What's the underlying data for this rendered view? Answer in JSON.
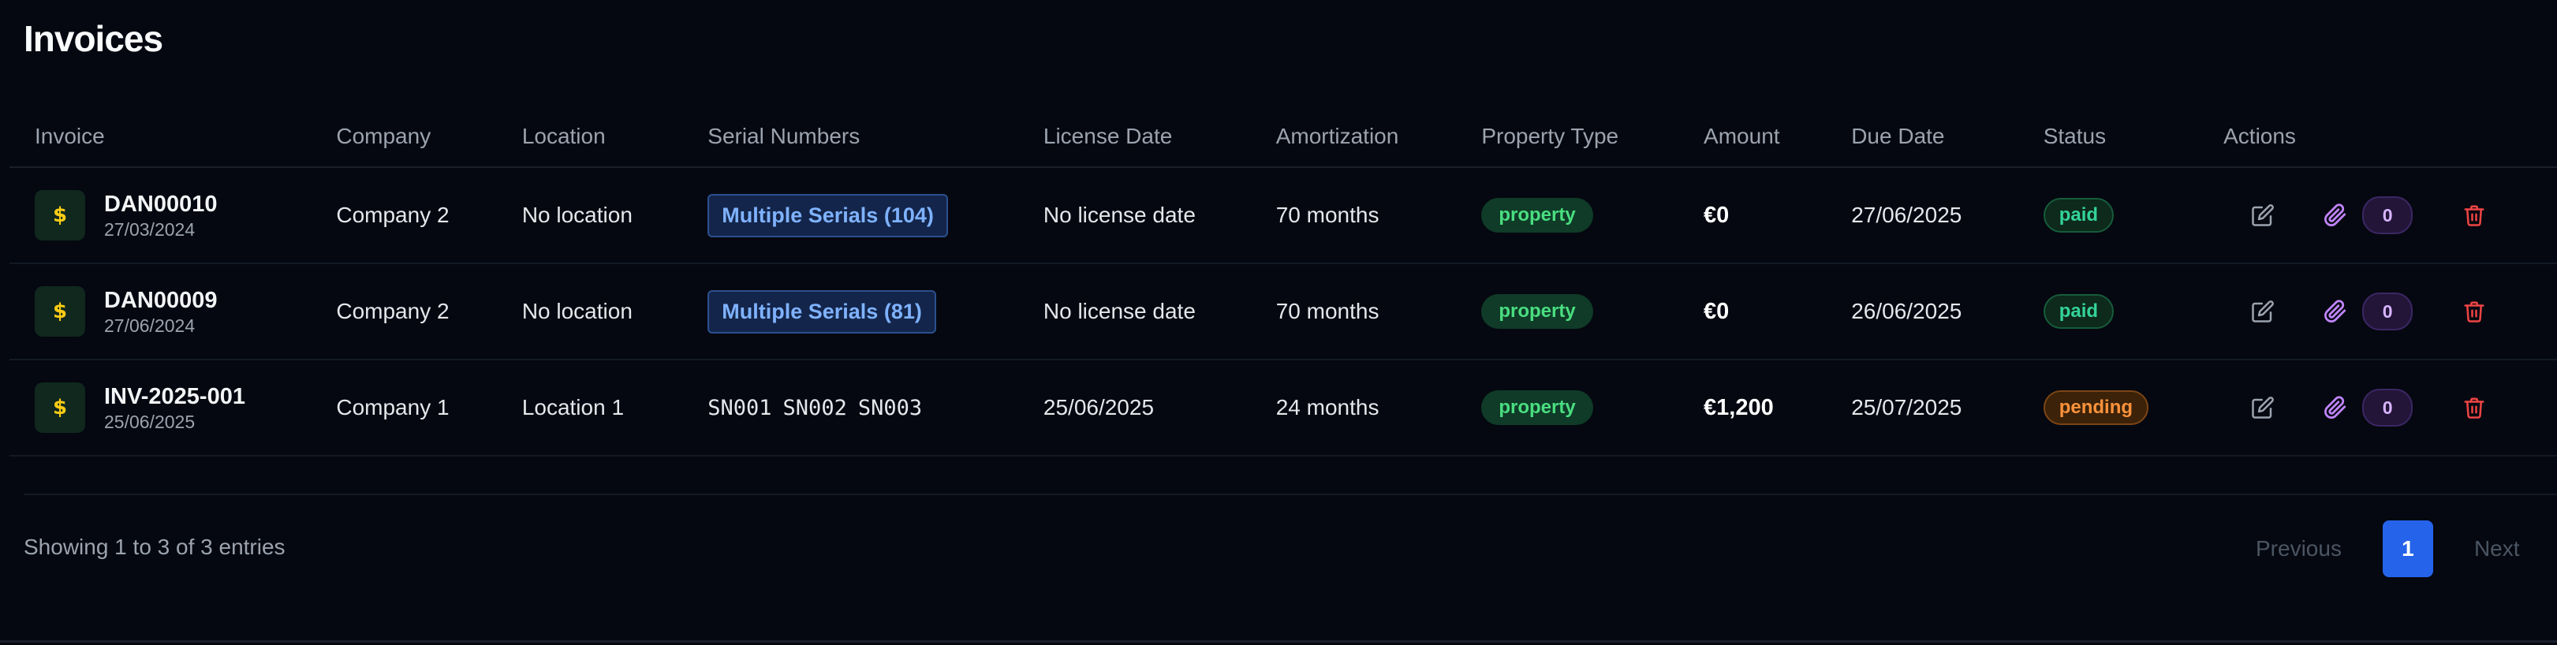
{
  "page": {
    "title": "Invoices"
  },
  "table": {
    "headers": [
      "Invoice",
      "Company",
      "Location",
      "Serial Numbers",
      "License Date",
      "Amortization",
      "Property Type",
      "Amount",
      "Due Date",
      "Status",
      "Actions"
    ],
    "rows": [
      {
        "invoice_number": "DAN00010",
        "invoice_date": "27/03/2024",
        "icon": "money-bag-icon",
        "company": "Company 2",
        "location": "No location",
        "serials_badge": "Multiple Serials (104)",
        "license_date": "No license date",
        "amortization": "70 months",
        "property_type": "property",
        "amount": "€0",
        "due_date": "27/06/2025",
        "status": "paid",
        "attachments": "0"
      },
      {
        "invoice_number": "DAN00009",
        "invoice_date": "27/06/2024",
        "icon": "money-bag-icon",
        "company": "Company 2",
        "location": "No location",
        "serials_badge": "Multiple Serials (81)",
        "license_date": "No license date",
        "amortization": "70 months",
        "property_type": "property",
        "amount": "€0",
        "due_date": "26/06/2025",
        "status": "paid",
        "attachments": "0"
      },
      {
        "invoice_number": "INV-2025-001",
        "invoice_date": "25/06/2025",
        "icon": "money-bag-icon",
        "company": "Company 1",
        "location": "Location 1",
        "serials": [
          "SN001",
          "SN002",
          "SN003"
        ],
        "license_date": "25/06/2025",
        "amortization": "24 months",
        "property_type": "property",
        "amount": "€1,200",
        "due_date": "25/07/2025",
        "status": "pending",
        "attachments": "0"
      }
    ]
  },
  "footer": {
    "entries_text": "Showing 1 to 3 of 3 entries",
    "previous_label": "Previous",
    "current_page": "1",
    "next_label": "Next"
  },
  "colors": {
    "background": "#050810",
    "accent": "#2563eb",
    "paid": "#34d399",
    "pending": "#fb923c",
    "delete": "#ef4444",
    "attachment": "#c084fc"
  }
}
